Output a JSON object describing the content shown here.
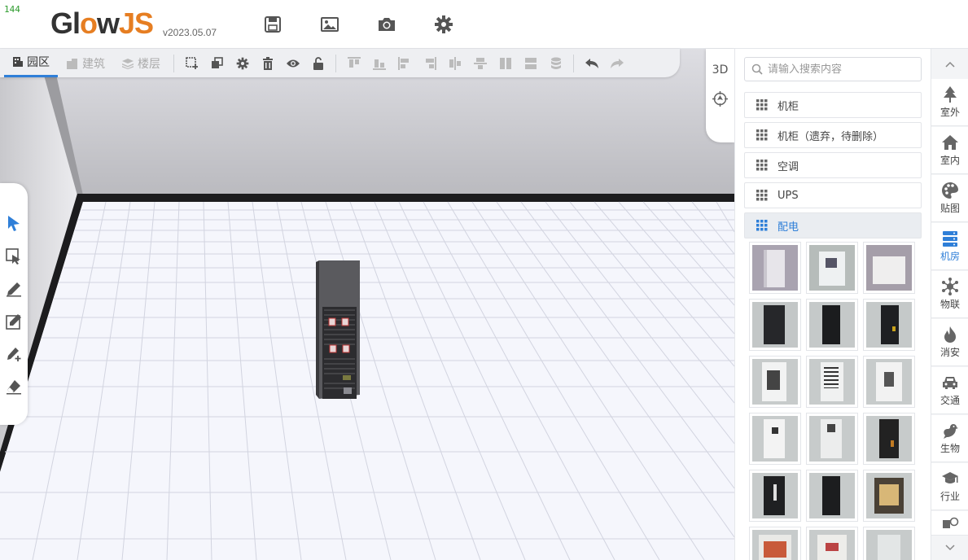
{
  "fps_counter": "144",
  "app": {
    "logo_prefix": "Gl",
    "logo_o": "o",
    "logo_w": "w",
    "logo_suffix": "JS",
    "version": "v2023.05.07"
  },
  "top_actions": [
    {
      "name": "save-icon"
    },
    {
      "name": "image-icon"
    },
    {
      "name": "camera-icon"
    },
    {
      "name": "gear-icon"
    }
  ],
  "toolbar": {
    "tabs": [
      {
        "label": "园区",
        "icon": "building-icon"
      },
      {
        "label": "建筑",
        "icon": "buildings-icon"
      },
      {
        "label": "楼层",
        "icon": "layers-icon"
      }
    ]
  },
  "view_control": {
    "mode_label": "3D"
  },
  "search": {
    "placeholder": "请输入搜索内容"
  },
  "categories": [
    {
      "label": "机柜"
    },
    {
      "label": "机柜（遗弃，待删除）"
    },
    {
      "label": "空调"
    },
    {
      "label": "UPS"
    },
    {
      "label": "配电",
      "active": true
    }
  ],
  "side_nav": [
    {
      "label": "室外",
      "icon": "tree-icon"
    },
    {
      "label": "室内",
      "icon": "home-icon"
    },
    {
      "label": "贴图",
      "icon": "palette-icon"
    },
    {
      "label": "机房",
      "icon": "server-icon",
      "active": true
    },
    {
      "label": "物联",
      "icon": "network-icon"
    },
    {
      "label": "消安",
      "icon": "fire-icon"
    },
    {
      "label": "交通",
      "icon": "car-icon"
    },
    {
      "label": "生物",
      "icon": "bird-icon"
    },
    {
      "label": "行业",
      "icon": "graduation-cap-icon"
    }
  ],
  "colors": {
    "accent": "#2f7fd8",
    "brand": "#e67e22"
  }
}
